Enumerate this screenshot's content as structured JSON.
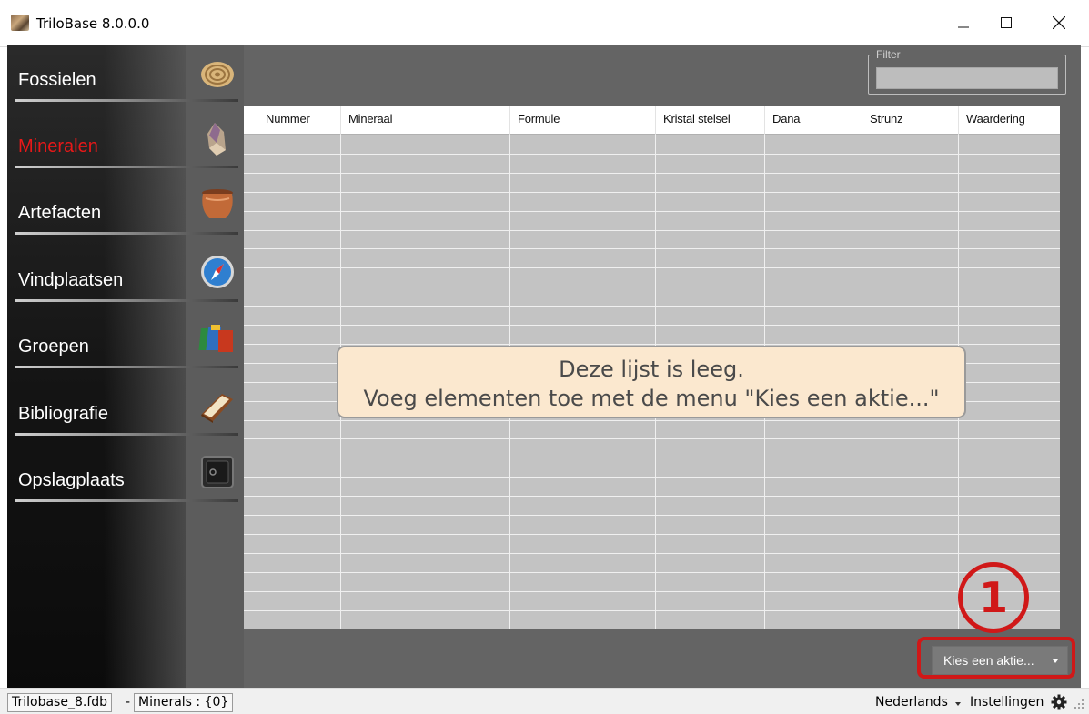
{
  "window": {
    "title": "TriloBase 8.0.0.0",
    "controls": [
      "minimize",
      "maximize",
      "close"
    ]
  },
  "sidebar": {
    "items": [
      {
        "label": "Fossielen",
        "icon": "ammonite-icon",
        "active": false
      },
      {
        "label": "Mineralen",
        "icon": "crystal-icon",
        "active": true
      },
      {
        "label": "Artefacten",
        "icon": "pot-icon",
        "active": false
      },
      {
        "label": "Vindplaatsen",
        "icon": "compass-icon",
        "active": false
      },
      {
        "label": "Groepen",
        "icon": "folders-icon",
        "active": false
      },
      {
        "label": "Bibliografie",
        "icon": "book-icon",
        "active": false
      },
      {
        "label": "Opslagplaats",
        "icon": "safe-icon",
        "active": false
      }
    ]
  },
  "filter": {
    "label": "Filter",
    "value": ""
  },
  "table": {
    "columns": [
      "Nummer",
      "Mineraal",
      "Formule",
      "Kristal stelsel",
      "Dana",
      "Strunz",
      "Waardering"
    ],
    "rows": []
  },
  "empty_message": {
    "line1": "Deze lijst is leeg.",
    "line2": "Voeg elementen toe met de menu \"Kies een aktie...\""
  },
  "actions": {
    "button_label": "Kies een aktie..."
  },
  "annotation": {
    "callout_number": "1",
    "color": "#d01818"
  },
  "statusbar": {
    "database": "Trilobase_8.fdb",
    "separator": "-",
    "records": "Minerals : {0}",
    "language": "Nederlands",
    "settings": "Instellingen"
  },
  "colors": {
    "active_nav": "#e81818",
    "main_bg": "#646464",
    "grid_bg": "#c3c3c3",
    "message_bg": "#fbe8cf"
  }
}
